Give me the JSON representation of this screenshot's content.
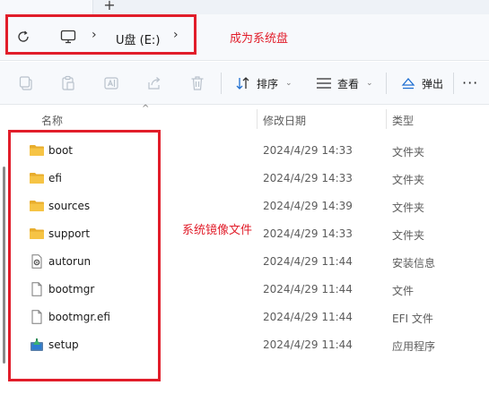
{
  "tabs": {
    "new_tab": "+"
  },
  "address": {
    "chevron": "›",
    "crumb": "U盘 (E:)",
    "annotation": "成为系统盘"
  },
  "toolbar": {
    "sort_label": "排序",
    "view_label": "查看",
    "eject_label": "弹出",
    "dropdown_glyph": "⌄",
    "more_glyph": "···"
  },
  "list": {
    "sort_glyph": "^",
    "columns": {
      "name": "名称",
      "date": "修改日期",
      "type": "类型"
    },
    "annotation": "系统镜像文件",
    "rows": [
      {
        "name": "boot",
        "date": "2024/4/29 14:33",
        "type": "文件夹",
        "icon": "folder-icon"
      },
      {
        "name": "efi",
        "date": "2024/4/29 14:33",
        "type": "文件夹",
        "icon": "folder-icon"
      },
      {
        "name": "sources",
        "date": "2024/4/29 14:39",
        "type": "文件夹",
        "icon": "folder-icon"
      },
      {
        "name": "support",
        "date": "2024/4/29 14:33",
        "type": "文件夹",
        "icon": "folder-icon"
      },
      {
        "name": "autorun",
        "date": "2024/4/29 11:44",
        "type": "安装信息",
        "icon": "settings-file-icon"
      },
      {
        "name": "bootmgr",
        "date": "2024/4/29 11:44",
        "type": "文件",
        "icon": "file-icon"
      },
      {
        "name": "bootmgr.efi",
        "date": "2024/4/29 11:44",
        "type": "EFI 文件",
        "icon": "file-icon"
      },
      {
        "name": "setup",
        "date": "2024/4/29 11:44",
        "type": "应用程序",
        "icon": "setup-app-icon"
      }
    ]
  },
  "colors": {
    "annotation_red": "#e11d2a",
    "folder_yellow": "#f6c445",
    "accent_blue": "#1f6fd1"
  }
}
